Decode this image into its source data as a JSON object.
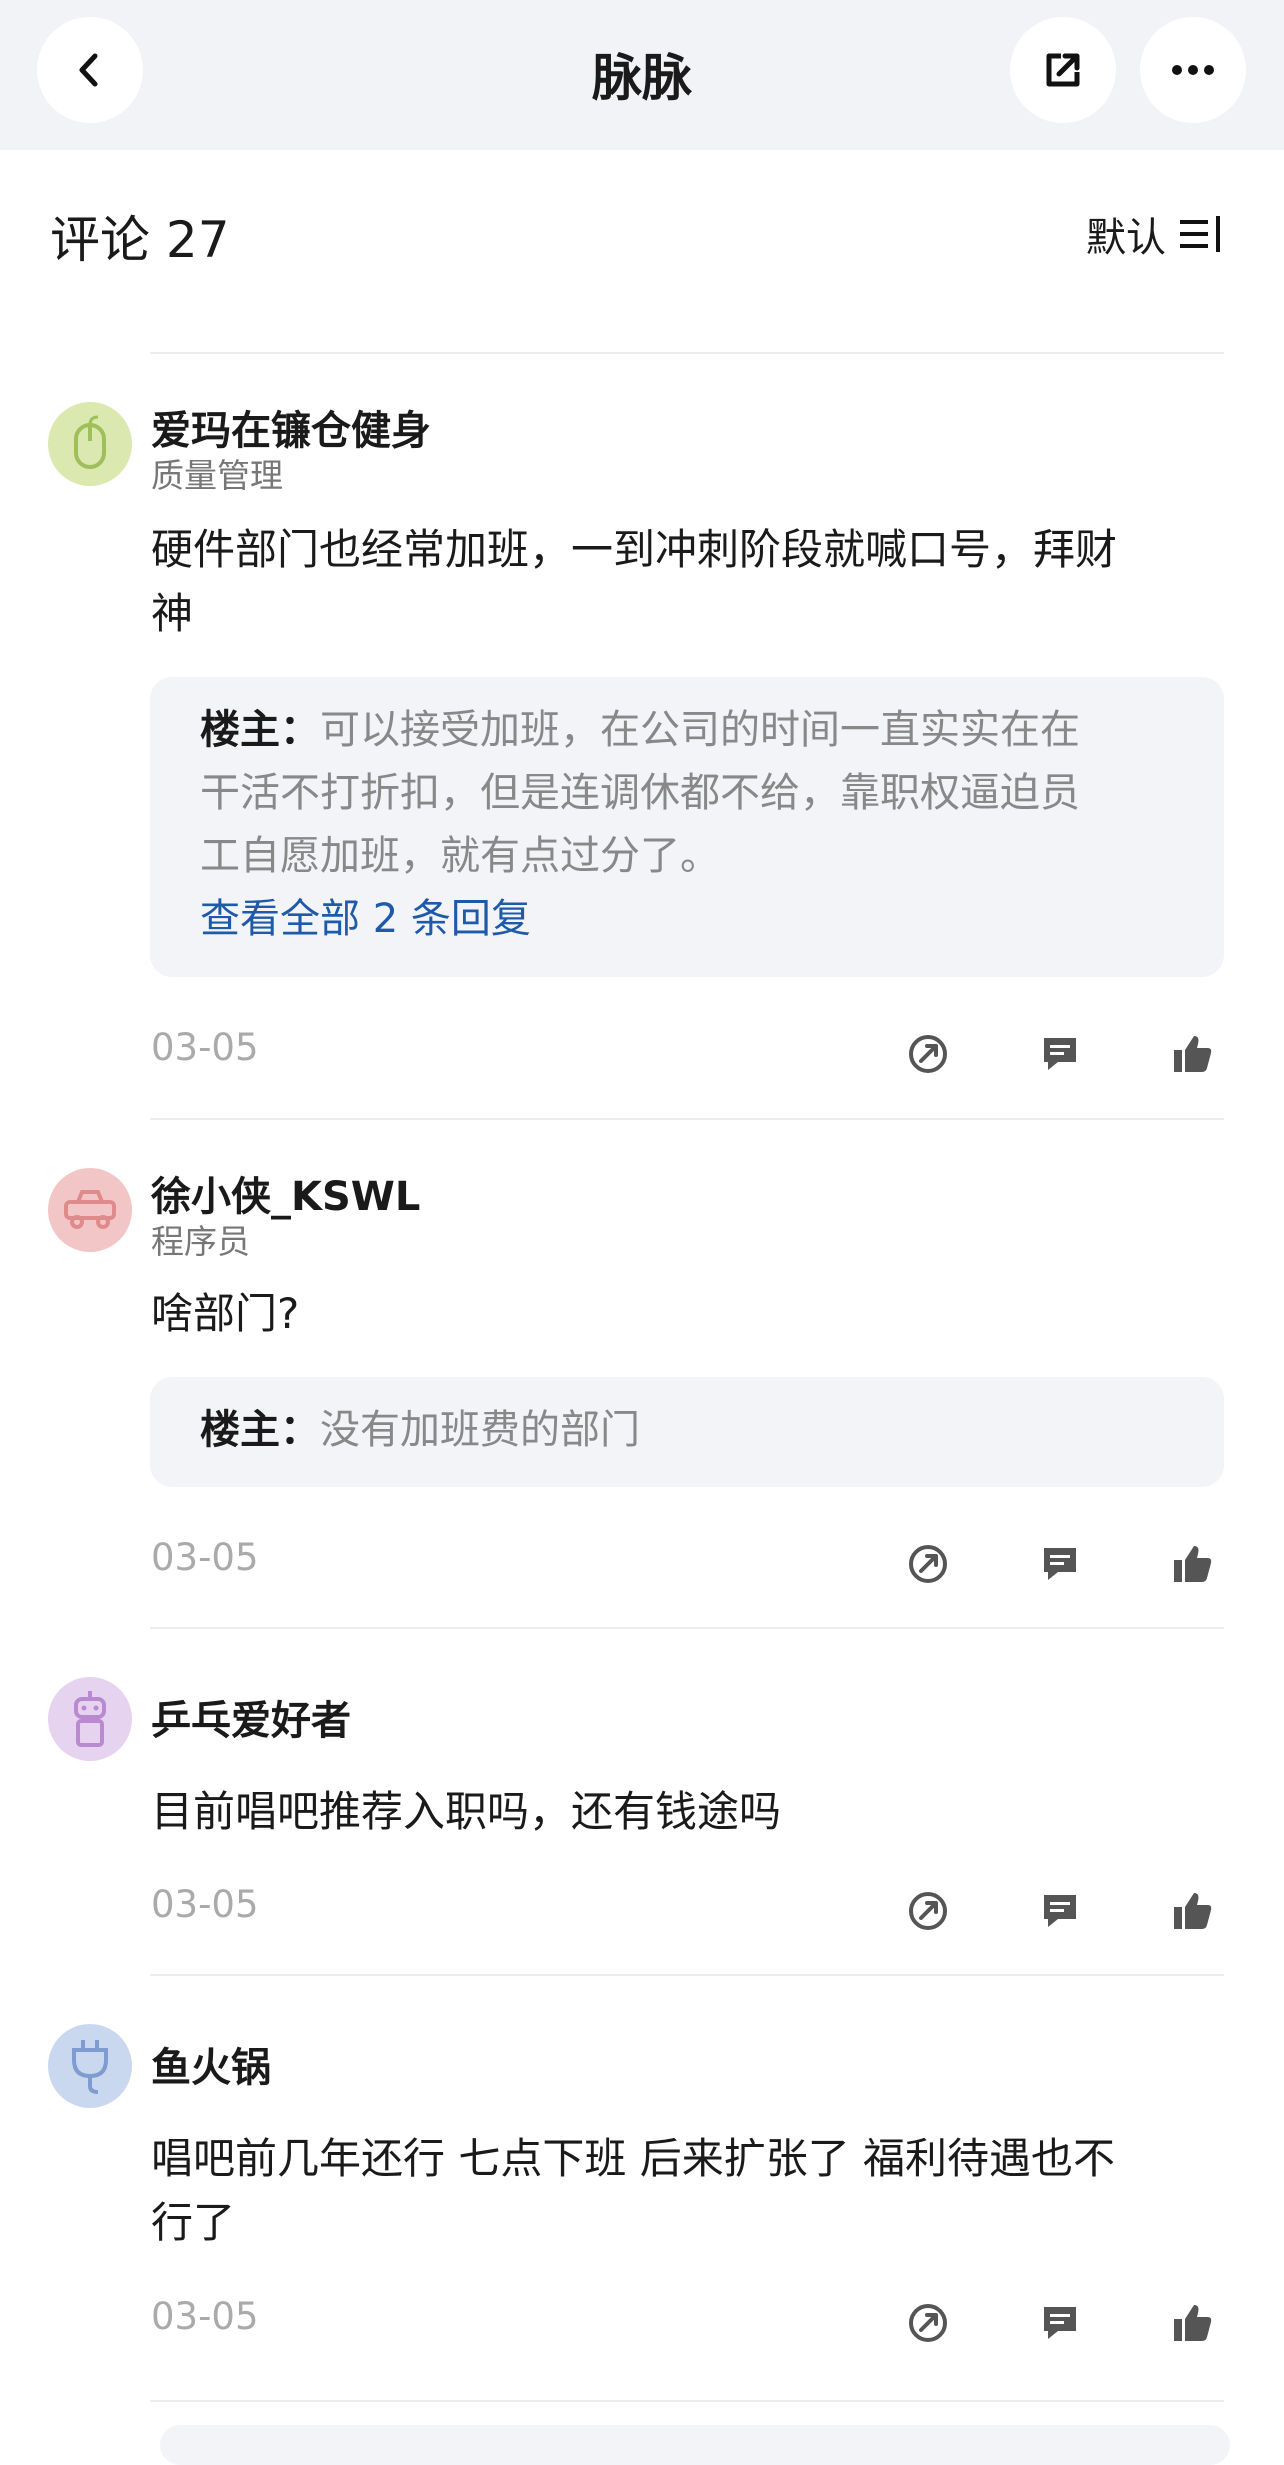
{
  "app": {
    "title": "脉脉"
  },
  "comments_header": {
    "label": "评论 27"
  },
  "sort": {
    "label": "默认"
  },
  "comments": [
    {
      "user": "爱玛在镰仓健身",
      "title": "质量管理",
      "text_lines": [
        "硬件部门也经常加班，一到冲刺阶段就喊口号，拜财",
        "神"
      ],
      "reply": {
        "author": "楼主：",
        "lines": [
          "可以接受加班，在公司的时间一直实实在在",
          "干活不打折扣，但是连调休都不给，靠职权逼迫员",
          "工自愿加班，就有点过分了。"
        ],
        "view_all": "查看全部 2 条回复"
      },
      "date": "03-05"
    },
    {
      "user": "徐小侠_KSWL",
      "title": "程序员",
      "text_lines": [
        "啥部门?"
      ],
      "reply": {
        "author": "楼主：",
        "lines": [
          "没有加班费的部门"
        ]
      },
      "date": "03-05"
    },
    {
      "user": "乒乓爱好者",
      "text_lines": [
        "目前唱吧推荐入职吗，还有钱途吗"
      ],
      "date": "03-05"
    },
    {
      "user": "鱼火锅",
      "text_lines": [
        "唱吧前几年还行 七点下班 后来扩张了 福利待遇也不",
        "行了"
      ],
      "date": "03-05"
    }
  ],
  "colors": {
    "link": "#1f5aa8",
    "reply_bg": "#f3f4f8",
    "topbar_bg": "#f2f3f7",
    "icon": "#555555"
  }
}
